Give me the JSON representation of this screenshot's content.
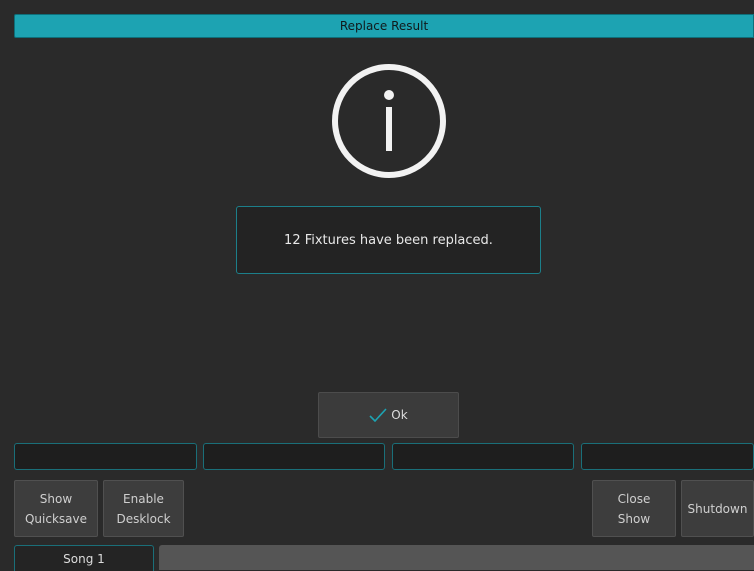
{
  "dialog": {
    "title": "Replace Result",
    "message": "12 Fixtures have been replaced.",
    "icon": "info-icon",
    "ok_label": "Ok",
    "ok_icon": "check-icon"
  },
  "colors": {
    "accent": "#1da3b2",
    "background": "#2a2a2a",
    "button": "#3d3d3d"
  },
  "toolbar": {
    "show_quicksave": "Show\nQuicksave",
    "enable_desklock": "Enable\nDesklock",
    "close_show": "Close\nShow",
    "shutdown": "Shutdown"
  },
  "tabs": {
    "song": "Song 1"
  }
}
